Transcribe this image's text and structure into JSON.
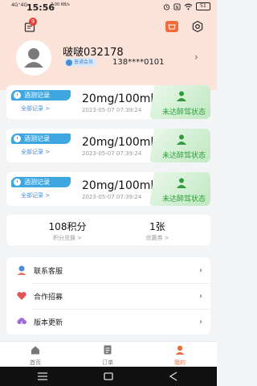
{
  "status_bar": {
    "network": "4G⁺4G",
    "time": "15:56",
    "speed": "7.00 KB/s",
    "battery": "51"
  },
  "header": {
    "message_badge": "9"
  },
  "profile": {
    "username": "啵啵032178",
    "member_label": "普通会员",
    "phone": "138****0101"
  },
  "records": [
    {
      "tag": "酒测记录",
      "all_link": "全部记录 >",
      "value": "20mg/100ml",
      "datetime": "2023-05-07 07:39:24",
      "status": "未达醉驾状态"
    },
    {
      "tag": "酒测记录",
      "all_link": "全部记录 >",
      "value": "20mg/100ml",
      "datetime": "2023-05-07 07:39:24",
      "status": "未达醉驾状态"
    },
    {
      "tag": "酒测记录",
      "all_link": "全部记录 >",
      "value": "20mg/100ml",
      "datetime": "2023-05-07 07:39:24",
      "status": "未达醉驾状态"
    }
  ],
  "stats": {
    "points": "108积分",
    "points_label": "积分兑换 >",
    "coupons": "1张",
    "coupons_label": "优惠券 >"
  },
  "menu": [
    {
      "label": "联系客服",
      "icon": "customer-service-icon"
    },
    {
      "label": "合作招募",
      "icon": "handshake-icon"
    },
    {
      "label": "版本更新",
      "icon": "update-icon"
    }
  ],
  "tabbar": {
    "home": "首页",
    "orders": "订单",
    "mine": "我的"
  },
  "colors": {
    "accent": "#f26b3a",
    "tag_blue": "#3fa7e0",
    "status_green": "#2f9b3b",
    "header_bg": "#fbe3d9"
  }
}
